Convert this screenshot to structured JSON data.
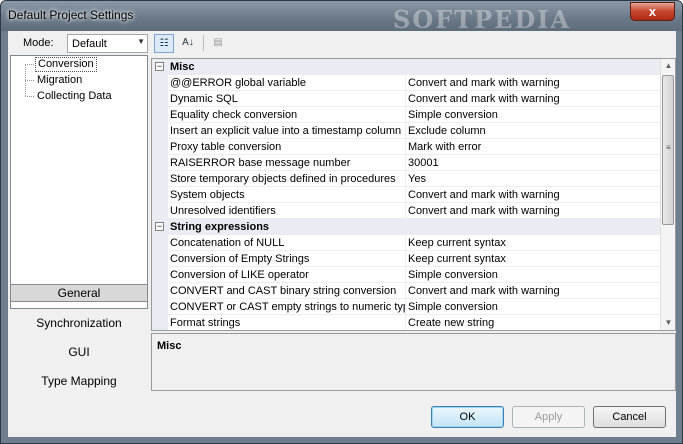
{
  "window": {
    "title": "Default Project Settings",
    "watermark": "SOFTPEDIA",
    "close_glyph": "x"
  },
  "toolbar": {
    "mode_label": "Mode:",
    "mode_value": "Default",
    "categorized_glyph": "☷",
    "alphabetical_glyph": "A↓",
    "pages_glyph": "▤"
  },
  "tree": {
    "items": [
      "Conversion",
      "Migration",
      "Collecting Data"
    ],
    "selected": "Conversion"
  },
  "nav": [
    "General",
    "Synchronization",
    "GUI",
    "Type Mapping"
  ],
  "grid": {
    "categories": [
      {
        "name": "Misc",
        "props": [
          {
            "name": "@@ERROR global variable",
            "value": "Convert and mark with warning"
          },
          {
            "name": "Dynamic SQL",
            "value": "Convert and mark with warning"
          },
          {
            "name": "Equality check conversion",
            "value": "Simple conversion"
          },
          {
            "name": "Insert an explicit value into a timestamp column",
            "value": "Exclude column"
          },
          {
            "name": "Proxy table conversion",
            "value": "Mark with error"
          },
          {
            "name": "RAISERROR base message number",
            "value": "30001"
          },
          {
            "name": "Store temporary objects defined in procedures",
            "value": "Yes"
          },
          {
            "name": "System objects",
            "value": "Convert and mark with warning"
          },
          {
            "name": "Unresolved identifiers",
            "value": "Convert and mark with warning"
          }
        ]
      },
      {
        "name": "String expressions",
        "props": [
          {
            "name": "Concatenation of NULL",
            "value": "Keep current syntax"
          },
          {
            "name": "Conversion of Empty Strings",
            "value": "Keep current syntax"
          },
          {
            "name": "Conversion of LIKE operator",
            "value": "Simple conversion"
          },
          {
            "name": "CONVERT and CAST binary string conversion",
            "value": "Convert and mark with warning"
          },
          {
            "name": "CONVERT or CAST empty strings to numeric type",
            "value": "Simple conversion"
          },
          {
            "name": "Format strings",
            "value": "Create new string"
          }
        ]
      }
    ]
  },
  "description": {
    "title": "Misc"
  },
  "buttons": {
    "ok": "OK",
    "apply": "Apply",
    "cancel": "Cancel"
  }
}
